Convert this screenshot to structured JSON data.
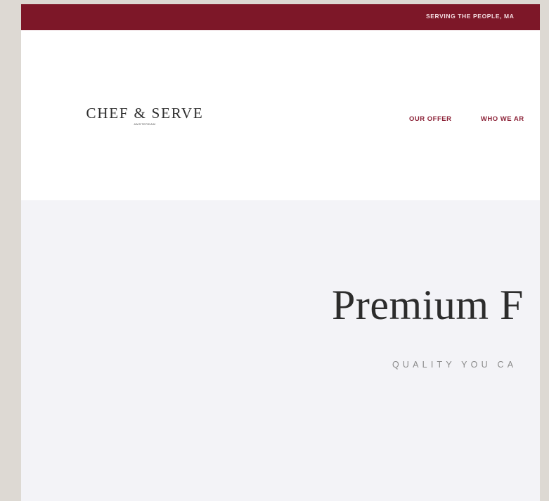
{
  "announcement": {
    "text": "SERVING THE PEOPLE, MA"
  },
  "header": {
    "logo": {
      "title": "CHEF & SERVE",
      "subtitle": "AMSTERDAM"
    },
    "nav": [
      {
        "label": "OUR OFFER"
      },
      {
        "label": "WHO WE AR"
      }
    ]
  },
  "hero": {
    "title": "Premium F",
    "subtitle": "QUALITY YOU CA"
  },
  "colors": {
    "brand": "#7d1728",
    "nav_text": "#8c2338",
    "hero_bg": "#f3f3f7",
    "page_bg": "#ddd9d3"
  }
}
